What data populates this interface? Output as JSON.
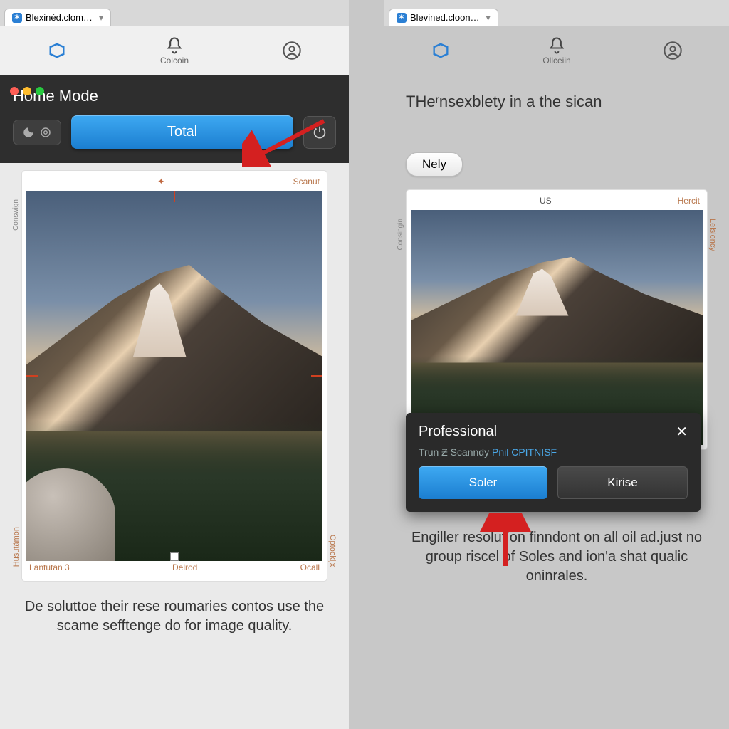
{
  "left": {
    "tab_title": "Blexinéd.clom…",
    "appbar": {
      "center_label": "Colcoin"
    },
    "toolbar_title": "Home Mode",
    "btn_total": "Total",
    "preview": {
      "top_left": "",
      "top_center_icon": "pin-icon",
      "top_right": "Scanut",
      "bottom_left": "Lantutan 3",
      "bottom_center": "Delrod",
      "bottom_right": "Ocall",
      "side_left": "Husutämon",
      "side_right": "Optockijx",
      "side_left_top": "Conswign"
    },
    "caption": "De soluttoe their rese roumaries contos use the scame sefftenge do for image quality."
  },
  "right": {
    "tab_title": "Blevined.cloon…",
    "appbar": {
      "center_label": "Ollceiin"
    },
    "heading": "THeʳnsexblety in a the sican",
    "nely_btn": "Nely",
    "preview": {
      "top_center": "US",
      "top_right": "Hercit",
      "side_left_top": "Consingin",
      "side_right": "Lelsioncy"
    },
    "modal": {
      "title": "Professional",
      "subtitle_a": "Trun Ƶ Scanndy",
      "subtitle_b": "Pnil CPITNISF",
      "btn_primary": "Soler",
      "btn_secondary": "Kirise"
    },
    "caption": "Engiller resolutíon finndont on all oil ad.just no group riscel of Soles and ion'a shat qualic oninrales."
  }
}
